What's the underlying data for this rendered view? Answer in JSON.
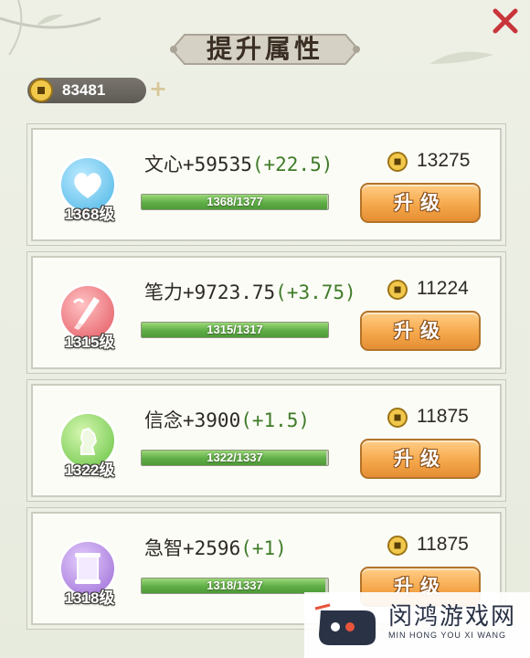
{
  "header": {
    "title": "提升属性",
    "close_icon": "close-icon"
  },
  "currency": {
    "icon": "coin-icon",
    "value": "83481",
    "add_icon": "plus-icon",
    "add_label": "+"
  },
  "attributes": [
    {
      "title": "文心+59535",
      "delta": "(+22.5)",
      "level": "1368级",
      "progress": "1368/1377",
      "progress_fraction": 0.993,
      "cost": "13275",
      "button_label": "升级",
      "icon": "heart-icon",
      "icon_color": "#4bb6e6"
    },
    {
      "title": "笔力+9723.75",
      "delta": "(+3.75)",
      "level": "1315级",
      "progress": "1315/1317",
      "progress_fraction": 0.998,
      "cost": "11224",
      "button_label": "升级",
      "icon": "brush-icon",
      "icon_color": "#e2555e"
    },
    {
      "title": "信念+3900",
      "delta": "(+1.5)",
      "level": "1322级",
      "progress": "1322/1337",
      "progress_fraction": 0.989,
      "cost": "11875",
      "button_label": "升级",
      "icon": "statue-icon",
      "icon_color": "#66c242"
    },
    {
      "title": "急智+2596",
      "delta": "(+1)",
      "level": "1318级",
      "progress": "1318/1337",
      "progress_fraction": 0.986,
      "cost": "11875",
      "button_label": "升级",
      "icon": "scroll-icon",
      "icon_color": "#9a6ad6"
    }
  ],
  "watermark": {
    "name": "闵鸿游戏网",
    "pinyin": "MIN HONG YOU XI WANG"
  },
  "colors": {
    "accent_orange": "#f6a84c",
    "progress_green": "#5fae46",
    "close_red": "#c8353a"
  }
}
